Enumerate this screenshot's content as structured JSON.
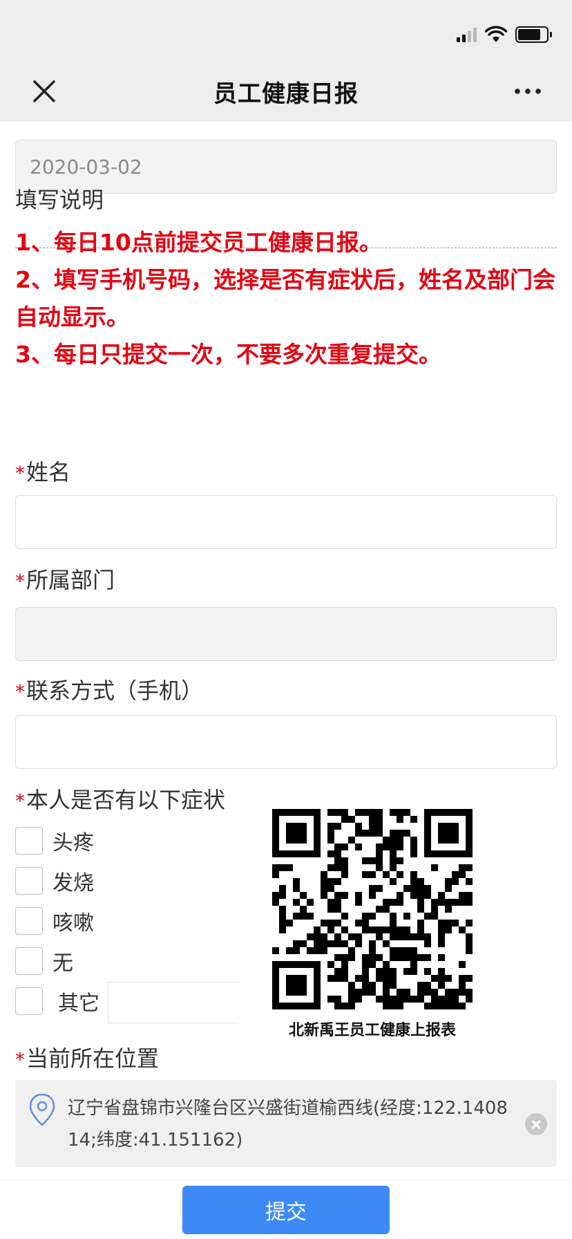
{
  "header": {
    "title": "员工健康日报",
    "close_icon": "close-icon",
    "more_icon": "more-icon"
  },
  "status_bar": {
    "icons": [
      "signal-icon",
      "wifi-icon",
      "battery-icon"
    ]
  },
  "form": {
    "date_value": "2020-03-02",
    "instructions_label": "填写说明",
    "notice_lines": [
      "1、每日10点前提交员工健康日报。",
      "2、填写手机号码，选择是否有症状后，姓名及部门会自动显示。",
      "3、每日只提交一次，不要多次重复提交。"
    ],
    "required_mark": "*",
    "name_label": "姓名",
    "name_value": "",
    "department_label": "所属部门",
    "department_value": "",
    "phone_label": "联系方式（手机）",
    "phone_value": "",
    "symptoms_label": "本人是否有以下症状",
    "symptoms": [
      "头疼",
      "发烧",
      "咳嗽",
      "无",
      "其它"
    ],
    "location_label": "当前所在位置",
    "location_value": "辽宁省盘锦市兴隆台区兴盛街道榆西线(经度:122.140814;纬度:41.151162)"
  },
  "qr": {
    "caption": "北新禹王员工健康上报表"
  },
  "footer": {
    "submit_label": "提交"
  },
  "colors": {
    "accent": "#3d8af7",
    "required": "#e60012",
    "header_bg": "#ededed"
  }
}
